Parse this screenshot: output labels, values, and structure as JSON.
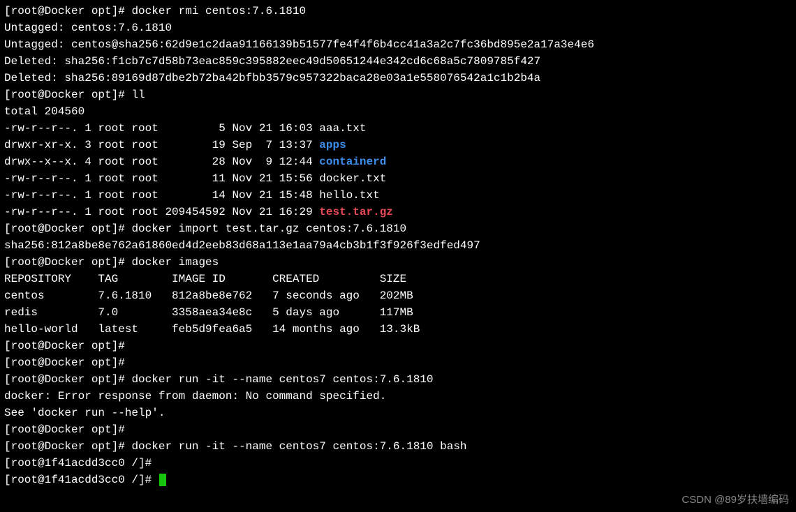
{
  "prompt1": "[root@Docker opt]# ",
  "prompt2": "[root@1f41acdd3cc0 /]# ",
  "cmd_rmi": "docker rmi centos:7.6.1810",
  "rmi_out1": "Untagged: centos:7.6.1810",
  "rmi_out2": "Untagged: centos@sha256:62d9e1c2daa91166139b51577fe4f4f6b4cc41a3a2c7fc36bd895e2a17a3e4e6",
  "rmi_out3": "Deleted: sha256:f1cb7c7d58b73eac859c395882eec49d50651244e342cd6c68a5c7809785f427",
  "rmi_out4": "Deleted: sha256:89169d87dbe2b72ba42bfbb3579c957322baca28e03a1e558076542a1c1b2b4a",
  "cmd_ll": "ll",
  "ll_total": "total 204560",
  "ll_row1": "-rw-r--r--. 1 root root         5 Nov 21 16:03 aaa.txt",
  "ll_row2_pre": "drwxr-xr-x. 3 root root        19 Sep  7 13:37 ",
  "ll_row2_name": "apps",
  "ll_row3_pre": "drwx--x--x. 4 root root        28 Nov  9 12:44 ",
  "ll_row3_name": "containerd",
  "ll_row4": "-rw-r--r--. 1 root root        11 Nov 21 15:56 docker.txt",
  "ll_row5": "-rw-r--r--. 1 root root        14 Nov 21 15:48 hello.txt",
  "ll_row6_pre": "-rw-r--r--. 1 root root 209454592 Nov 21 16:29 ",
  "ll_row6_name": "test.tar.gz",
  "cmd_import": "docker import test.tar.gz centos:7.6.1810",
  "import_out": "sha256:812a8be8e762a61860ed4d2eeb83d68a113e1aa79a4cb3b1f3f926f3edfed497",
  "cmd_images": "docker images",
  "images_hdr": "REPOSITORY    TAG        IMAGE ID       CREATED         SIZE",
  "images_r1": "centos        7.6.1810   812a8be8e762   7 seconds ago   202MB",
  "images_r2": "redis         7.0        3358aea34e8c   5 days ago      117MB",
  "images_r3": "hello-world   latest     feb5d9fea6a5   14 months ago   13.3kB",
  "cmd_run1": "docker run -it --name centos7 centos:7.6.1810",
  "run1_out1": "docker: Error response from daemon: No command specified.",
  "run1_out2": "See 'docker run --help'.",
  "cmd_run2": "docker run -it --name centos7 centos:7.6.1810 bash",
  "watermark": "CSDN @89岁扶墙编码"
}
